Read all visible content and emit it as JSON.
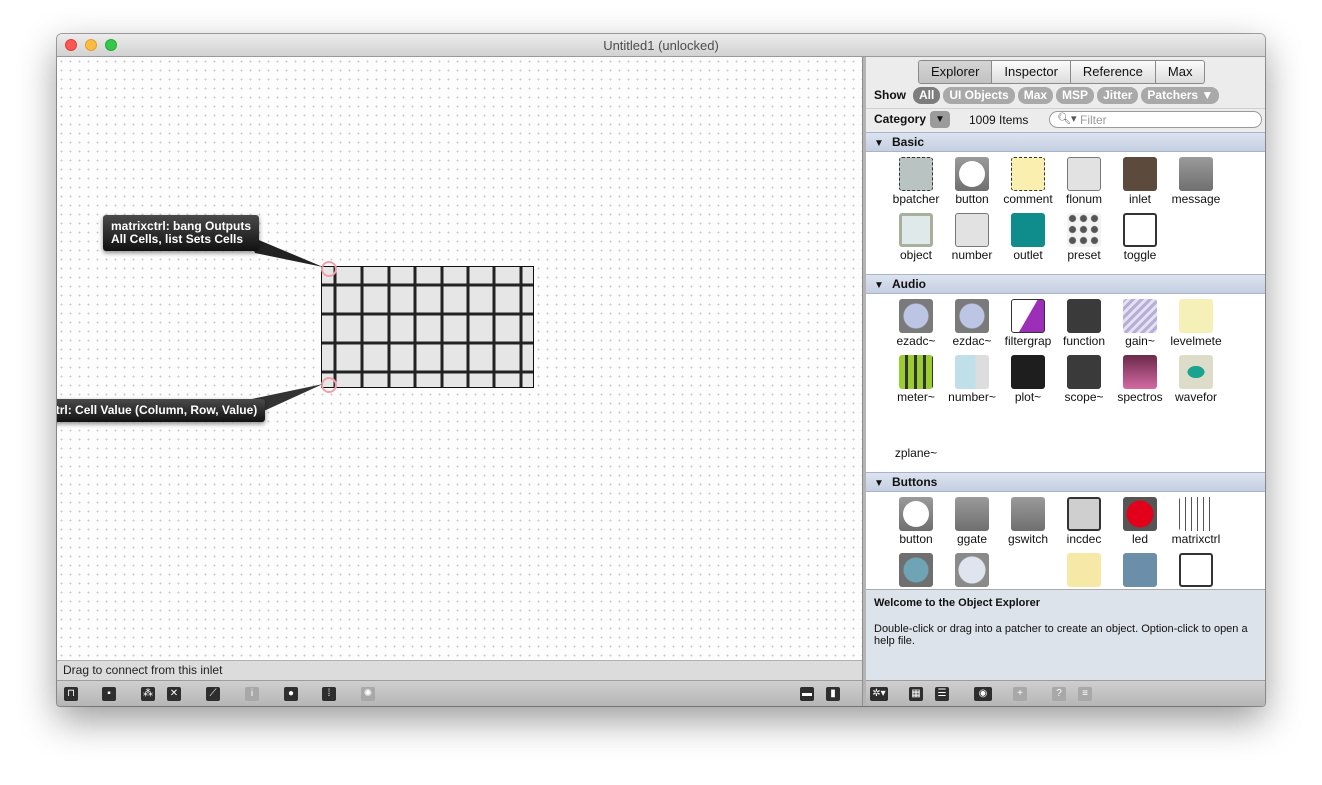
{
  "window": {
    "title": "Untitled1 (unlocked)"
  },
  "patcher": {
    "status_text": "Drag to connect from this inlet",
    "tooltips": {
      "left_inlet": [
        "matrixctrl: bang Outputs",
        "All Cells, list Sets Cells"
      ],
      "right_outlet": [
        "matrixctrl: Cell Value (Column, Row, Value)"
      ]
    },
    "toolbar_icons": [
      "lock-icon",
      "presentation-icon",
      "new-object-icon",
      "delete-icon",
      "edit-icon",
      "info-icon",
      "connect-icon",
      "grid-icon",
      "paint-icon",
      "split-bottom-icon",
      "split-right-icon"
    ]
  },
  "explorer": {
    "tabs": [
      "Explorer",
      "Inspector",
      "Reference",
      "Max"
    ],
    "active_tab": "Explorer",
    "show_label": "Show",
    "show_filters": [
      "All",
      "UI Objects",
      "Max",
      "MSP",
      "Jitter",
      "Patchers ▼"
    ],
    "active_filter": "All",
    "category_label": "Category",
    "category_arrow": "▼",
    "item_count": "1009 Items",
    "filter_placeholder": "Filter",
    "sections": [
      {
        "name": "Basic",
        "items": [
          "bpatcher",
          "button",
          "comment",
          "flonum",
          "inlet",
          "message",
          "object",
          "number",
          "outlet",
          "preset",
          "toggle"
        ]
      },
      {
        "name": "Audio",
        "items": [
          "ezadc~",
          "ezdac~",
          "filtergrap",
          "function",
          "gain~",
          "levelmete",
          "meter~",
          "number~",
          "plot~",
          "scope~",
          "spectros",
          "wavefor",
          "zplane~"
        ]
      },
      {
        "name": "Buttons",
        "items": [
          "button",
          "ggate",
          "gswitch",
          "incdec",
          "led",
          "matrixctrl",
          "",
          "",
          "",
          "",
          "",
          ""
        ]
      }
    ],
    "info": {
      "title": "Welcome to the Object Explorer",
      "body": "Double-click or drag into a patcher to create an object. Option-click to open a help file."
    },
    "toolbar_icons": [
      "gear-icon",
      "icon-view-icon",
      "list-view-icon",
      "eye-icon",
      "add-icon",
      "help-icon",
      "menu-icon"
    ]
  },
  "colors": {
    "section_header": "#c9d3e6",
    "inlet_highlight": "#f0a0a6",
    "led_red": "#e3001b",
    "outlet_teal": "#0f8c8c"
  }
}
